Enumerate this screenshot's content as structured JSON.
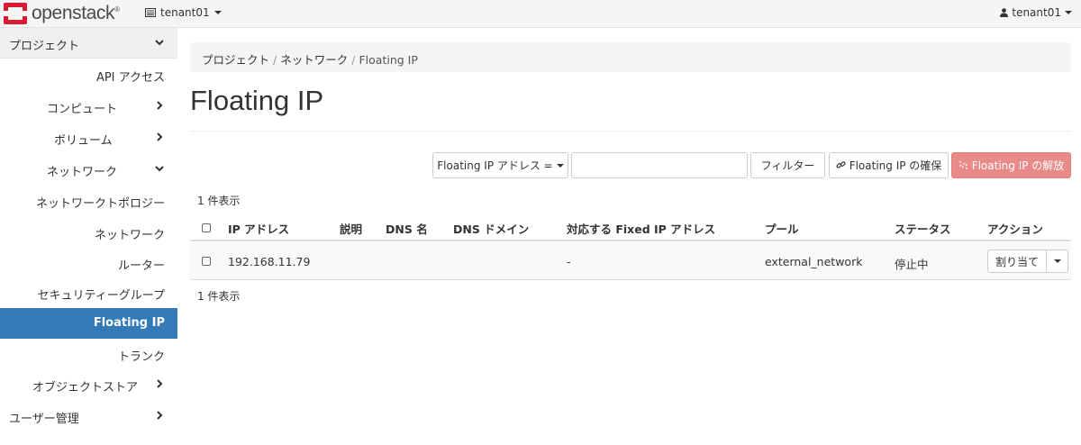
{
  "navbar": {
    "logo_text": "openstack",
    "logo_reg": "®",
    "project_selector": "tenant01",
    "user": "tenant01"
  },
  "sidebar": {
    "project": "プロジェクト",
    "api_access": "API アクセス",
    "compute": "コンピュート",
    "volume": "ボリューム",
    "network": "ネットワーク",
    "network_topology": "ネットワークトポロジー",
    "networks": "ネットワーク",
    "routers": "ルーター",
    "security_groups": "セキュリティーグループ",
    "floating_ip": "Floating IP",
    "trunk": "トランク",
    "object_store": "オブジェクトストア",
    "user_management": "ユーザー管理"
  },
  "breadcrumb": {
    "items": [
      "プロジェクト",
      "ネットワーク",
      "Floating IP"
    ],
    "separator": "/"
  },
  "page": {
    "title": "Floating IP"
  },
  "toolbar": {
    "filter_field": "Floating IP アドレス =",
    "filter_value": "",
    "filter_button": "フィルター",
    "allocate_button": "Floating IP の確保",
    "release_button": "Floating IP の解放"
  },
  "table": {
    "count_top": "1 件表示",
    "count_bottom": "1 件表示",
    "columns": [
      "IP アドレス",
      "説明",
      "DNS 名",
      "DNS ドメイン",
      "対応する Fixed IP アドレス",
      "プール",
      "ステータス",
      "アクション"
    ],
    "rows": [
      {
        "ip_address": "192.168.11.79",
        "description": "",
        "dns_name": "",
        "dns_domain": "",
        "fixed_ip": "-",
        "pool": "external_network",
        "status": "停止中",
        "action": "割り当て"
      }
    ]
  },
  "colors": {
    "active": "#337ab7",
    "danger": "#e88a87",
    "logo_red": "#da1a32"
  }
}
